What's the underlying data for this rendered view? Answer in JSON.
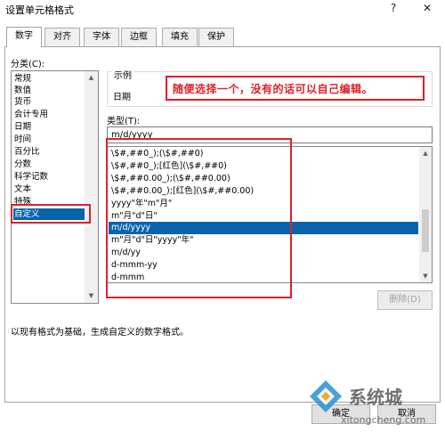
{
  "window": {
    "title": "设置单元格格式",
    "help": "?",
    "close": "✕"
  },
  "tabs": [
    {
      "label": "数字"
    },
    {
      "label": "对齐"
    },
    {
      "label": "字体"
    },
    {
      "label": "边框"
    },
    {
      "label": "填充"
    },
    {
      "label": "保护"
    }
  ],
  "category": {
    "label": "分类(C):",
    "items": [
      "常规",
      "数值",
      "货币",
      "会计专用",
      "日期",
      "时间",
      "百分比",
      "分数",
      "科学记数",
      "文本",
      "特殊",
      "自定义"
    ],
    "selected": "自定义"
  },
  "sample": {
    "label": "示例",
    "value": "日期"
  },
  "type": {
    "label": "类型(T):",
    "value": "m/d/yyyy",
    "items": [
      "\\$#,##0_);(\\$#,##0)",
      "\\$#,##0_);[红色](\\$#,##0)",
      "\\$#,##0.00_);(\\$#,##0.00)",
      "\\$#,##0.00_);[红色](\\$#,##0.00)",
      "yyyy\"年\"m\"月\"",
      "m\"月\"d\"日\"",
      "m/d/yyyy",
      "m\"月\"d\"日\"yyyy\"年\"",
      "m/d/yy",
      "d-mmm-yy",
      "d-mmm"
    ],
    "selected": "m/d/yyyy"
  },
  "buttons": {
    "delete": "删除(D)",
    "ok": "确定",
    "cancel": "取消"
  },
  "description": "以现有格式为基础，生成自定义的数字格式。",
  "annotation": {
    "text": "随便选择一个，没有的话可以自己编辑。",
    "color": "#e0202a"
  },
  "watermark": {
    "brand": "系统城",
    "url": "xitongcheng.com"
  },
  "colors": {
    "selection": "#0a64ad",
    "annotation": "#e0202a"
  }
}
